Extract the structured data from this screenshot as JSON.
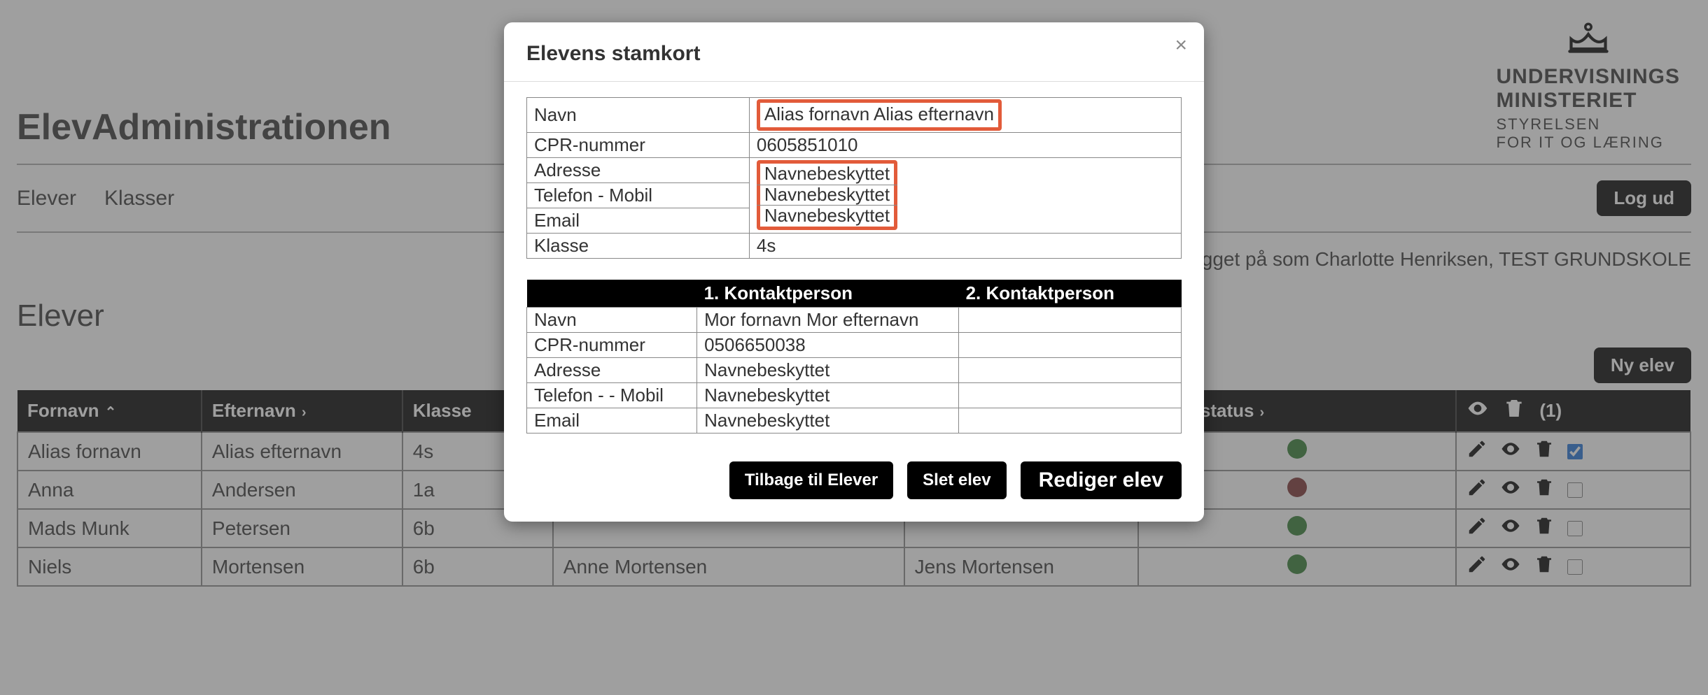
{
  "brand": {
    "line1": "UNDERVISNINGS",
    "line2": "MINISTERIET",
    "line3": "STYRELSEN",
    "line4": "FOR IT OG LÆRING"
  },
  "app_title": "ElevAdministrationen",
  "nav": {
    "elever": "Elever",
    "klasser": "Klasser",
    "logout": "Log ud"
  },
  "logged_in": "gget på som Charlotte Henriksen, TEST GRUNDSKOLE",
  "section_title": "Elever",
  "ny_elev": "Ny elev",
  "headers": {
    "fornavn": "Fornavn",
    "efternavn": "Efternavn",
    "klasse": "Klasse",
    "importstatus": "mportstatus",
    "count": "(1)"
  },
  "rows": [
    {
      "fornavn": "Alias fornavn",
      "efternavn": "Alias efternavn",
      "klasse": "4s",
      "k1": "",
      "k2": "",
      "status_color": "#2f7a2f",
      "checked": true
    },
    {
      "fornavn": "Anna",
      "efternavn": "Andersen",
      "klasse": "1a",
      "k1": "",
      "k2": "",
      "status_color": "#7a2f2f",
      "checked": false
    },
    {
      "fornavn": "Mads Munk",
      "efternavn": "Petersen",
      "klasse": "6b",
      "k1": "",
      "k2": "",
      "status_color": "#2f7a2f",
      "checked": false
    },
    {
      "fornavn": "Niels",
      "efternavn": "Mortensen",
      "klasse": "6b",
      "k1": "Anne Mortensen",
      "k2": "Jens Mortensen",
      "status_color": "#2f7a2f",
      "checked": false
    }
  ],
  "modal": {
    "title": "Elevens stamkort",
    "student": {
      "navn_label": "Navn",
      "navn": "Alias fornavn Alias efternavn",
      "cpr_label": "CPR-nummer",
      "cpr": "0605851010",
      "adresse_label": "Adresse",
      "adresse": "Navnebeskyttet",
      "telefon_label": "Telefon - Mobil",
      "telefon": "Navnebeskyttet",
      "email_label": "Email",
      "email": "Navnebeskyttet",
      "klasse_label": "Klasse",
      "klasse": "4s"
    },
    "contacts": {
      "h1": "1. Kontaktperson",
      "h2": "2. Kontaktperson",
      "navn_label": "Navn",
      "navn1": "Mor fornavn Mor efternavn",
      "navn2": "",
      "cpr_label": "CPR-nummer",
      "cpr1": "0506650038",
      "cpr2": "",
      "adresse_label": "Adresse",
      "adresse1": "Navnebeskyttet",
      "adresse2": "",
      "telefon_label": "Telefon - - Mobil",
      "telefon1": "Navnebeskyttet",
      "telefon2": "",
      "email_label": "Email",
      "email1": "Navnebeskyttet",
      "email2": ""
    },
    "actions": {
      "back": "Tilbage til Elever",
      "delete": "Slet elev",
      "edit": "Rediger elev"
    }
  }
}
